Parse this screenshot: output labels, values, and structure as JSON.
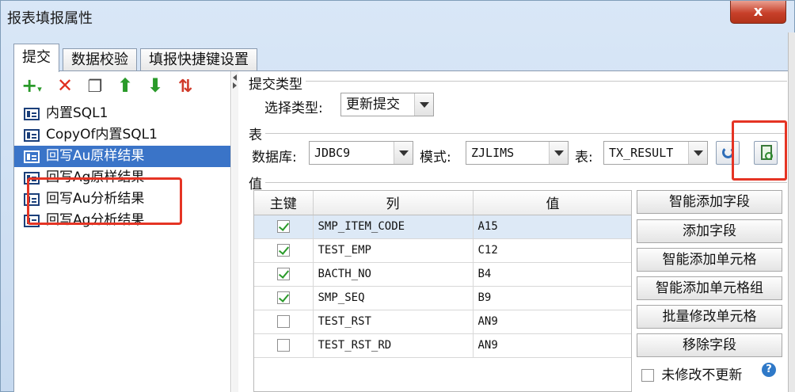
{
  "window": {
    "title": "报表填报属性",
    "close_label": "x"
  },
  "tabs": [
    {
      "label": "提交",
      "active": true
    },
    {
      "label": "数据校验",
      "active": false
    },
    {
      "label": "填报快捷键设置",
      "active": false
    }
  ],
  "toolbar": {
    "buttons": [
      {
        "icon": "add-icon",
        "glyph": "+",
        "color": "#2a9a2a"
      },
      {
        "icon": "delete-icon",
        "glyph": "✕",
        "color": "#e03020"
      },
      {
        "icon": "copy-icon",
        "glyph": "❐",
        "color": "#444444"
      },
      {
        "icon": "move-up-icon",
        "glyph": "⬆",
        "color": "#2a9a2a"
      },
      {
        "icon": "move-down-icon",
        "glyph": "⬇",
        "color": "#2a9a2a"
      },
      {
        "icon": "sort-icon",
        "glyph": "⇅",
        "color": "#d03a2a"
      }
    ]
  },
  "submit_list": [
    {
      "label": "内置SQL1",
      "selected": false
    },
    {
      "label": "CopyOf内置SQL1",
      "selected": false
    },
    {
      "label": "回写Au原样结果",
      "selected": true
    },
    {
      "label": "回写Ag原样结果",
      "selected": false
    },
    {
      "label": "回写Au分析结果",
      "selected": false
    },
    {
      "label": "回写Ag分析结果",
      "selected": false
    }
  ],
  "submit_type": {
    "section_title": "提交类型",
    "label": "选择类型:",
    "value": "更新提交"
  },
  "table_section": {
    "section_title": "表",
    "database_label": "数据库:",
    "database_value": "JDBC9",
    "schema_label": "模式:",
    "schema_value": "ZJLIMS",
    "table_label": "表:",
    "table_value": "TX_RESULT"
  },
  "values_section": {
    "section_title": "值",
    "columns": [
      "主键",
      "列",
      "值"
    ],
    "rows": [
      {
        "key": true,
        "column": "SMP_ITEM_CODE",
        "value": "A15",
        "selected": true
      },
      {
        "key": true,
        "column": "TEST_EMP",
        "value": "C12",
        "selected": false
      },
      {
        "key": true,
        "column": "BACTH_NO",
        "value": "B4",
        "selected": false
      },
      {
        "key": true,
        "column": "SMP_SEQ",
        "value": "B9",
        "selected": false
      },
      {
        "key": false,
        "column": "TEST_RST",
        "value": "AN9",
        "selected": false
      },
      {
        "key": false,
        "column": "TEST_RST_RD",
        "value": "AN9",
        "selected": false
      }
    ],
    "buttons": [
      "智能添加字段",
      "添加字段",
      "智能添加单元格",
      "智能添加单元格组",
      "批量修改单元格",
      "移除字段"
    ],
    "no_update_label": "未修改不更新",
    "help_glyph": "?"
  },
  "colors": {
    "selection": "#3a74c8",
    "highlight_box": "#e53424",
    "accent_green": "#2a9a2a"
  }
}
